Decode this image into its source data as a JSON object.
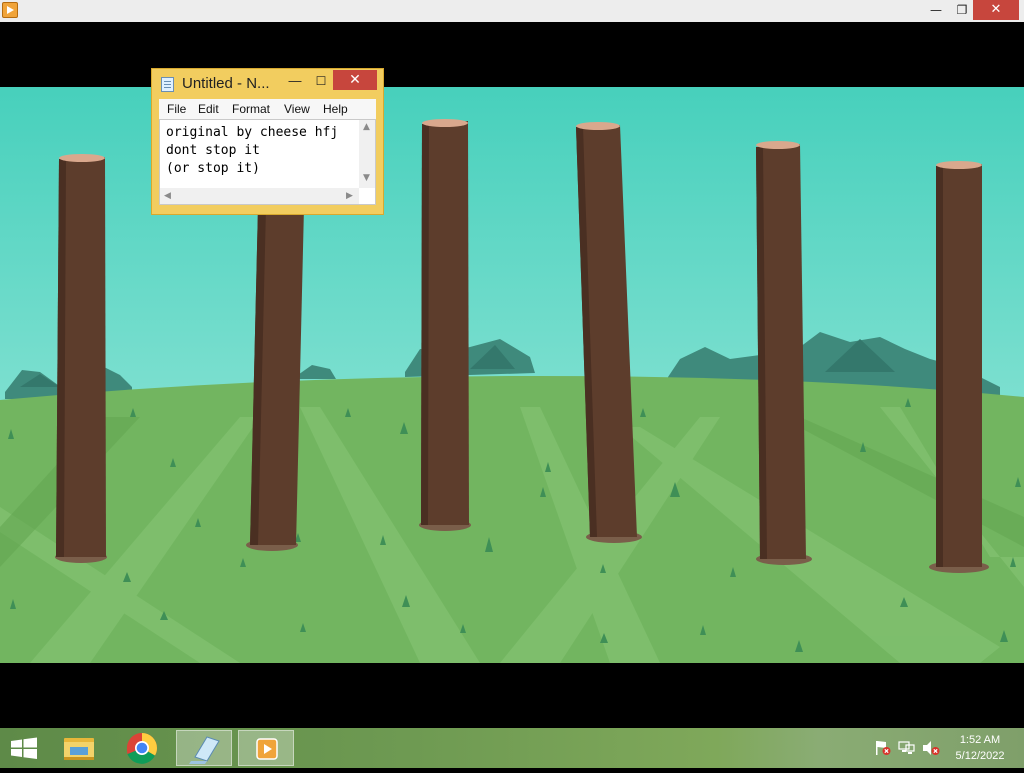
{
  "window": {
    "icon": "media-player-icon",
    "controls": {
      "minimize": "—",
      "restore": "❐",
      "close": "✕"
    }
  },
  "scene": {
    "sky_color": "#49d3be",
    "grass_color": "#72b560",
    "log_color": "#5d3d2c"
  },
  "notepad": {
    "title": "Untitled - N...",
    "controls": {
      "minimize": "—",
      "maximize": "☐",
      "close": "✕"
    },
    "menu": [
      "File",
      "Edit",
      "Format",
      "View",
      "Help"
    ],
    "text": "original by cheese hfj\ndont stop it\n(or stop it)"
  },
  "taskbar": {
    "start_icon": "windows-logo-icon",
    "apps": [
      {
        "name": "file-explorer",
        "icon": "folder-icon",
        "active": false
      },
      {
        "name": "chrome",
        "icon": "chrome-icon",
        "active": false
      },
      {
        "name": "notepad",
        "icon": "notepad-icon",
        "active": true
      },
      {
        "name": "media-player",
        "icon": "media-player-icon",
        "active": true
      }
    ],
    "tray": {
      "icons": [
        "action-center-flag-icon",
        "network-icon",
        "volume-muted-icon"
      ],
      "time": "1:52 AM",
      "date": "5/12/2022"
    }
  }
}
